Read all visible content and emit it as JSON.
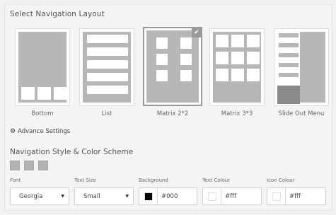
{
  "section_title": "Select Navigation Layout",
  "layouts": [
    {
      "label": "Bottom",
      "selected": false
    },
    {
      "label": "List",
      "selected": false
    },
    {
      "label": "Matrix 2*2",
      "selected": true
    },
    {
      "label": "Matrix 3*3",
      "selected": false
    },
    {
      "label": "Slide Out Menu",
      "selected": false
    }
  ],
  "selected_check_icon": "checkmark-icon",
  "advance_settings": {
    "icon": "gear-icon",
    "label": "Advance Settings"
  },
  "style_title": "Navigation Style & Color Scheme",
  "style_swatches": 3,
  "fields": {
    "font": {
      "label": "Font",
      "value": "Georgia"
    },
    "text_size": {
      "label": "Text Size",
      "value": "Small"
    },
    "background": {
      "label": "Background",
      "value": "#000",
      "chip_color": "#000000"
    },
    "text_colour": {
      "label": "Text Colour",
      "value": "#fff",
      "chip_color": "#ffffff"
    },
    "icon_colour": {
      "label": "Icon Colour",
      "value": "#fff",
      "chip_color": "#ffffff"
    }
  },
  "colors": {
    "preview_gray": "#b7b7b7",
    "panel_bg": "#f4f4f4"
  }
}
